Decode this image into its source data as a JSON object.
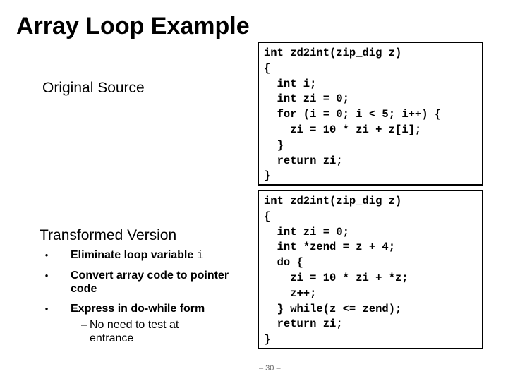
{
  "title": "Array Loop Example",
  "original": {
    "heading": "Original Source",
    "code": "int zd2int(zip_dig z)\n{\n  int i;\n  int zi = 0;\n  for (i = 0; i < 5; i++) {\n    zi = 10 * zi + z[i];\n  }\n  return zi;\n}"
  },
  "transformed": {
    "heading": "Transformed Version",
    "bullets": [
      {
        "bullet": "•",
        "text": "Eliminate loop variable ",
        "code": "i"
      },
      {
        "bullet": "•",
        "text": "Convert array code to pointer code"
      },
      {
        "bullet": "•",
        "text": "Express in do-while form"
      }
    ],
    "sub_bullet": {
      "dash": "–",
      "text": "No need to test at entrance"
    },
    "code": "int zd2int(zip_dig z)\n{\n  int zi = 0;\n  int *zend = z + 4;\n  do {\n    zi = 10 * zi + *z;\n    z++;\n  } while(z <= zend);\n  return zi;\n}"
  },
  "page_number": "– 30 –"
}
